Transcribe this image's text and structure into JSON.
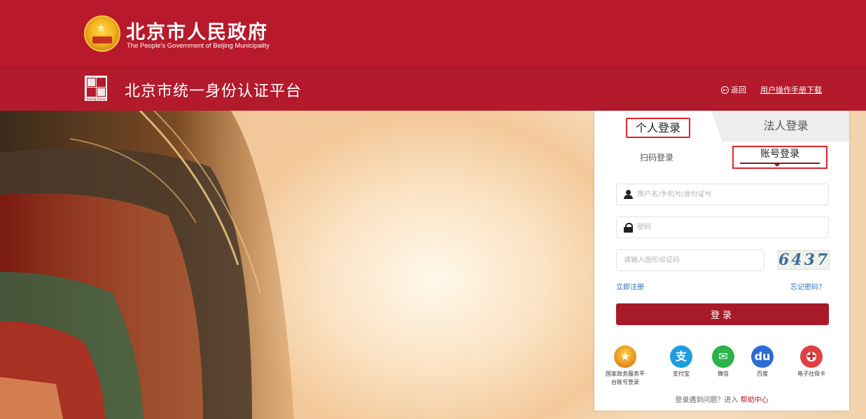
{
  "gov_header": {
    "title": "北京市人民政府",
    "subtitle": "The People's Government of Beijing Municipality"
  },
  "platform_bar": {
    "title": "北京市统一身份认证平台",
    "logo_caption": "Beijing·China",
    "back_label": "返回",
    "manual_label": "用户操作手册下载"
  },
  "login": {
    "tabs": {
      "personal": "个人登录",
      "legal": "法人登录"
    },
    "sub_tabs": {
      "scan": "扫码登录",
      "account": "账号登录"
    },
    "username_placeholder": "用户名/手机号/身份证号",
    "password_placeholder": "密码",
    "captcha_placeholder": "请输入图形验证码",
    "captcha_text": "6437",
    "register_label": "立即注册",
    "forgot_label": "忘记密码？",
    "submit_label": "登录",
    "social": [
      {
        "label": "国家政务服务平台账号登录",
        "icon": "national-gov-emblem-icon",
        "glyph": "★"
      },
      {
        "label": "支付宝",
        "icon": "alipay-icon",
        "glyph": "支"
      },
      {
        "label": "微信",
        "icon": "wechat-icon",
        "glyph": "✉"
      },
      {
        "label": "百度",
        "icon": "baidu-icon",
        "glyph": "du"
      },
      {
        "label": "电子社保卡",
        "icon": "social-security-card-icon",
        "glyph": "✚"
      }
    ],
    "help": {
      "prefix": "登录遇到问题？进入",
      "link": "帮助中心"
    }
  },
  "colors": {
    "header_red": "#b8192b",
    "platform_red": "#b31a2c",
    "button_red": "#a71a27",
    "link_blue": "#2b6fb8",
    "highlight_border": "#e0252e"
  }
}
